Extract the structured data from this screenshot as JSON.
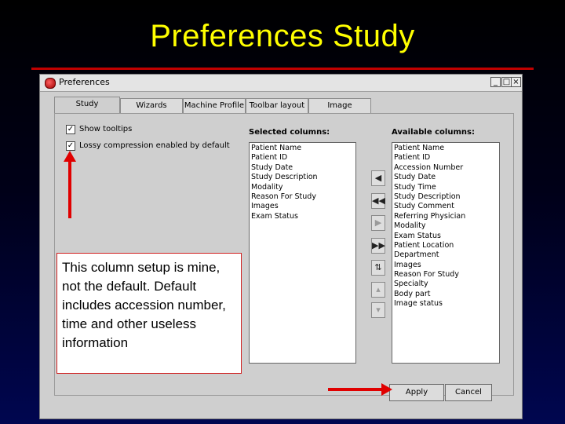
{
  "slide": {
    "title": "Preferences Study",
    "note": "This column setup is mine, not the default. Default includes accession number, time and other useless information"
  },
  "window": {
    "title": "Preferences",
    "icon": "app-icon",
    "controls": [
      "_",
      "□",
      "×"
    ]
  },
  "tabs": [
    {
      "label": "Study"
    },
    {
      "label": "Wizards"
    },
    {
      "label": "Machine Profile"
    },
    {
      "label": "Toolbar layout"
    },
    {
      "label": "Image"
    }
  ],
  "options": [
    {
      "label": "Show tooltips",
      "checked": true
    },
    {
      "label": "Lossy compression enabled by default",
      "checked": true
    }
  ],
  "selected_columns": {
    "heading": "Selected columns:",
    "items": [
      "Patient Name",
      "Patient ID",
      "Study Date",
      "Study Description",
      "Modality",
      "Reason For Study",
      "Images",
      "Exam Status"
    ]
  },
  "available_columns": {
    "heading": "Available columns:",
    "items": [
      "Patient Name",
      "Patient ID",
      "Accession Number",
      "Study Date",
      "Study Time",
      "Study Description",
      "Study Comment",
      "Referring Physician",
      "Modality",
      "Exam Status",
      "Patient Location",
      "Department",
      "Images",
      "Reason For Study",
      "Specialty",
      "Body part",
      "Image status"
    ]
  },
  "move_buttons": [
    {
      "icon": "move-left-icon",
      "glyph": "◀"
    },
    {
      "icon": "move-all-left-icon",
      "glyph": "◀◀"
    },
    {
      "icon": "move-right-icon",
      "glyph": "▶"
    },
    {
      "icon": "move-all-right-icon",
      "glyph": "▶▶"
    },
    {
      "icon": "reorder-icon",
      "glyph": "⇅"
    },
    {
      "icon": "move-up-icon",
      "glyph": "▴"
    },
    {
      "icon": "move-down-icon",
      "glyph": "▾"
    }
  ],
  "buttons": {
    "apply": "Apply",
    "cancel": "Cancel"
  },
  "colors": {
    "title": "#ffff00",
    "annotation": "#e00000"
  }
}
